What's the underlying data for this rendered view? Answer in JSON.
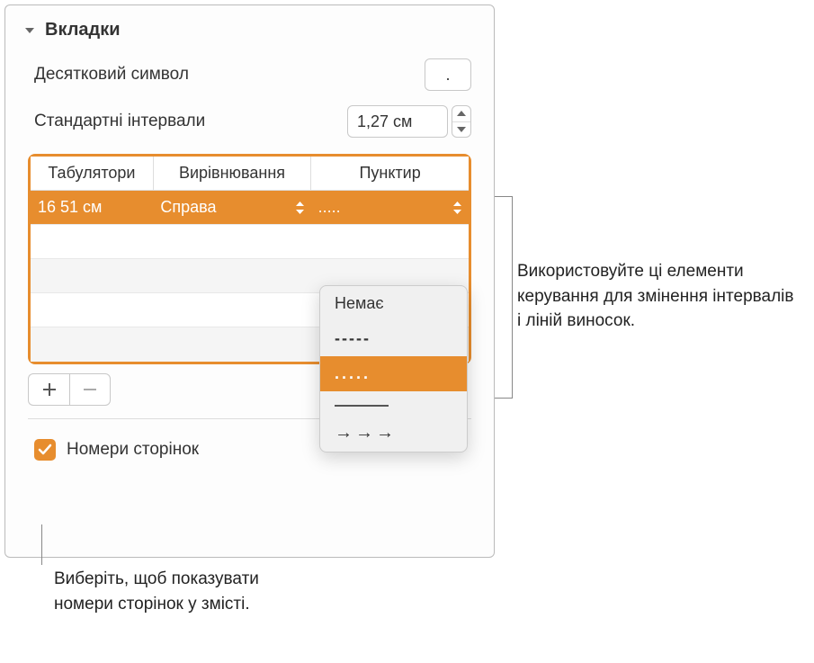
{
  "section": {
    "title": "Вкладки"
  },
  "decimal": {
    "label": "Десятковий символ",
    "value": "."
  },
  "spacing": {
    "label": "Стандартні інтервали",
    "value": "1,27 см"
  },
  "table": {
    "headers": {
      "tabs": "Табулятори",
      "alignment": "Вирівнювання",
      "leader": "Пунктир"
    },
    "rows": [
      {
        "tab": "16 51 см",
        "alignment": "Справа",
        "leader": "....."
      }
    ]
  },
  "dropdown": {
    "options": {
      "none": "Немає",
      "dashes": "-----",
      "dots": ".....",
      "underscore": "_____",
      "arrows": "→→→"
    }
  },
  "checkbox": {
    "label": "Номери сторінок",
    "checked": true
  },
  "callouts": {
    "right": "Використовуйте ці елементи керування для змінення інтервалів і ліній виносок.",
    "bottom": "Виберіть, щоб показувати номери сторінок у змісті."
  }
}
